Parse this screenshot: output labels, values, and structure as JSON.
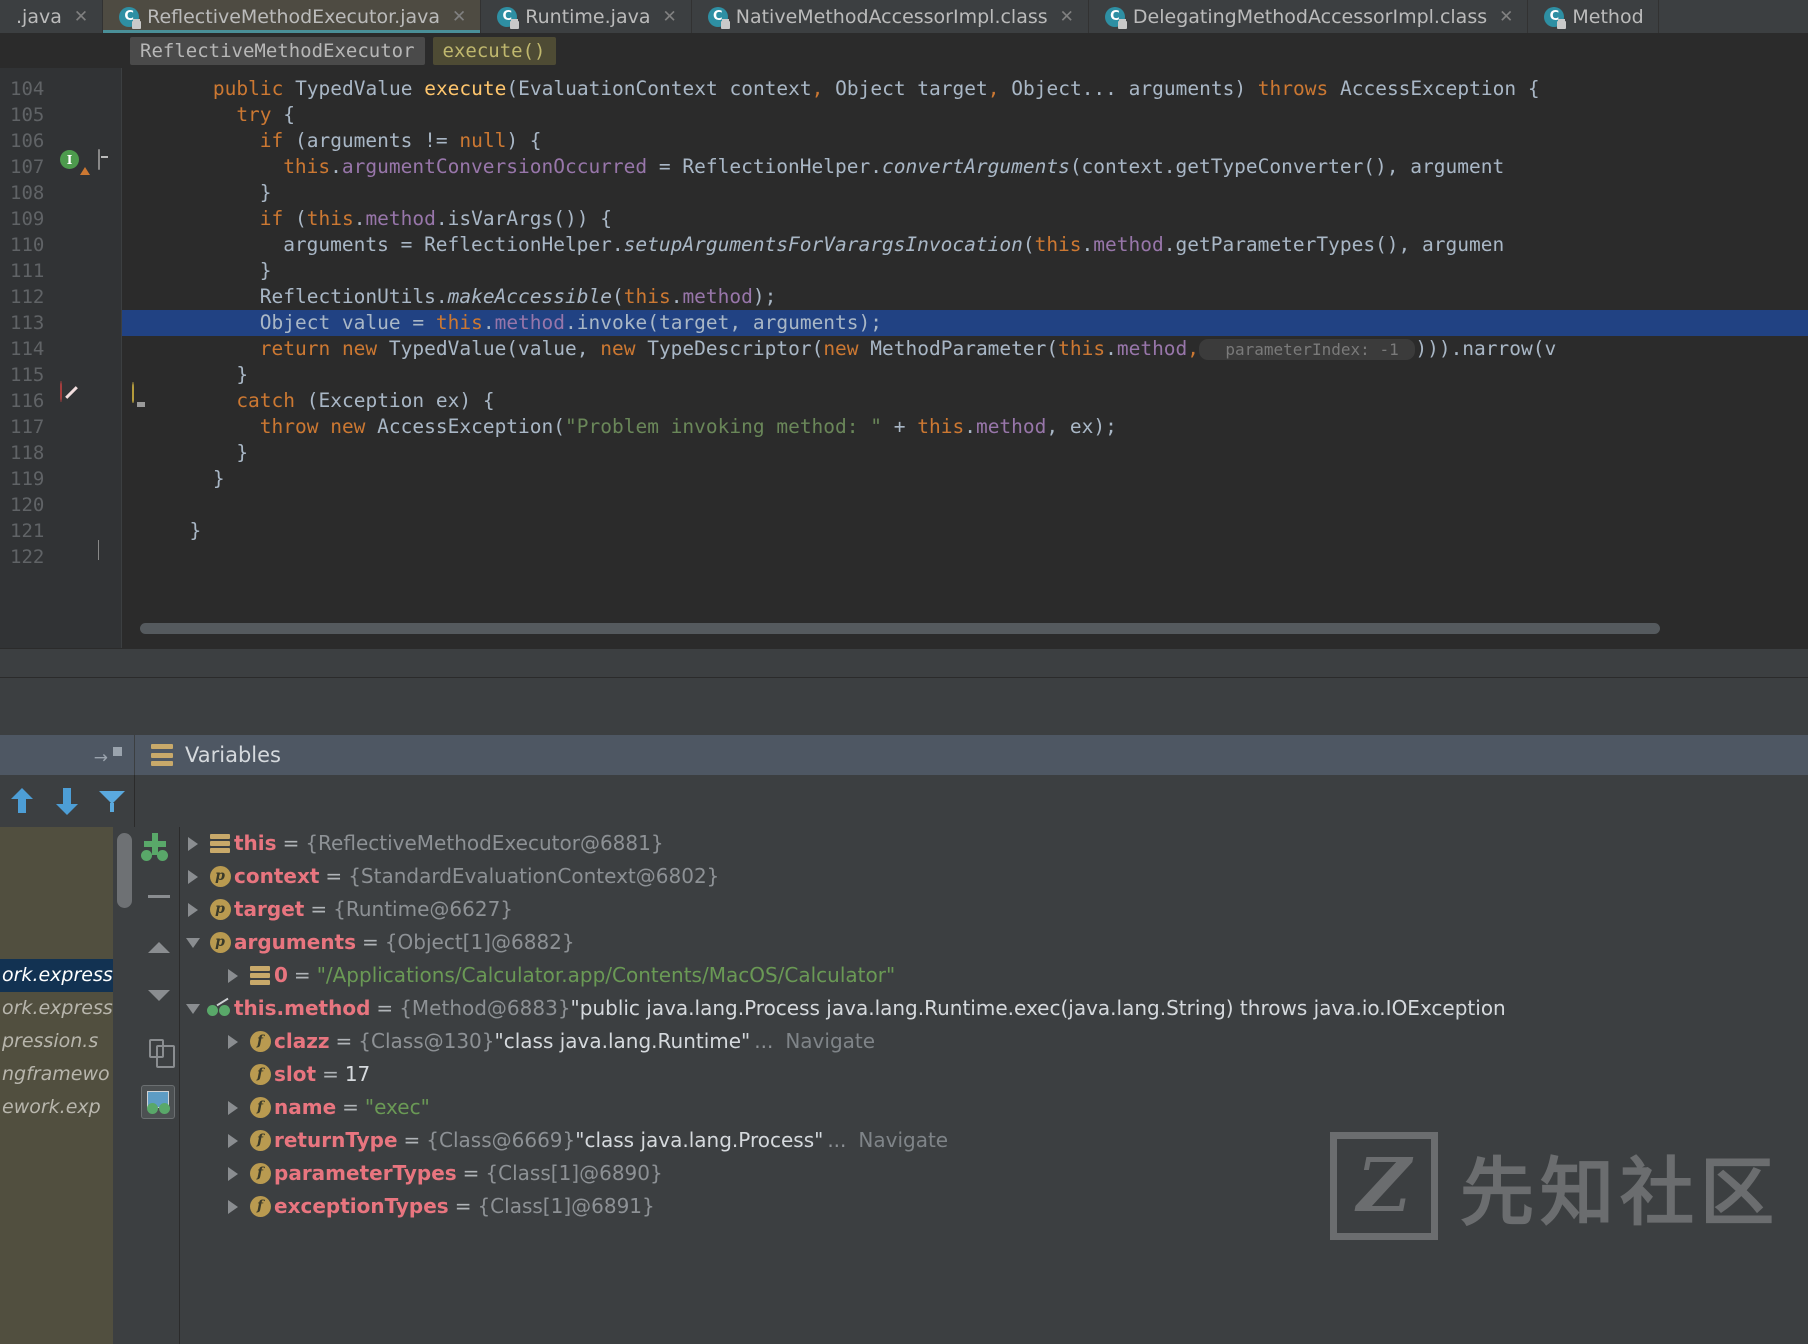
{
  "tabs": [
    {
      "label": ".java",
      "icon": "java-class-icon",
      "active": false,
      "truncated_left": true
    },
    {
      "label": "ReflectiveMethodExecutor.java",
      "icon": "java-class-icon",
      "active": true
    },
    {
      "label": "Runtime.java",
      "icon": "java-class-icon",
      "active": false
    },
    {
      "label": "NativeMethodAccessorImpl.class",
      "icon": "java-class-icon",
      "active": false
    },
    {
      "label": "DelegatingMethodAccessorImpl.class",
      "icon": "java-class-icon",
      "active": false
    },
    {
      "label": "Method",
      "icon": "java-class-icon",
      "active": false,
      "truncated_right": true
    }
  ],
  "tab_close_glyph": "✕",
  "class_icon_letter": "C",
  "breadcrumb": {
    "class": "ReflectiveMethodExecutor",
    "method": "execute()"
  },
  "editor": {
    "first_line": 104,
    "highlighted_line": 113,
    "breakpoint_line": 113,
    "lines": [
      {
        "n": 104,
        "indent": 2,
        "tokens": [
          {
            "t": "public ",
            "c": "kw"
          },
          {
            "t": "TypedValue ",
            "c": "cls"
          },
          {
            "t": "execute",
            "c": "mth"
          },
          {
            "t": "(",
            "c": "cls"
          },
          {
            "t": "EvaluationContext context",
            "c": "cls"
          },
          {
            "t": ",",
            "c": "kw"
          },
          {
            "t": " Object target",
            "c": "cls"
          },
          {
            "t": ",",
            "c": "kw"
          },
          {
            "t": " Object... arguments) ",
            "c": "cls"
          },
          {
            "t": "throws ",
            "c": "kw"
          },
          {
            "t": "AccessException {",
            "c": "cls"
          }
        ]
      },
      {
        "n": 105,
        "indent": 3,
        "tokens": [
          {
            "t": "try",
            "c": "kw"
          },
          {
            "t": " {",
            "c": "cls"
          }
        ]
      },
      {
        "n": 106,
        "indent": 4,
        "tokens": [
          {
            "t": "if",
            "c": "kw"
          },
          {
            "t": " (arguments != ",
            "c": "cls"
          },
          {
            "t": "null",
            "c": "kw"
          },
          {
            "t": ") {",
            "c": "cls"
          }
        ]
      },
      {
        "n": 107,
        "indent": 5,
        "tokens": [
          {
            "t": "this",
            "c": "kw"
          },
          {
            "t": ".",
            "c": "cls"
          },
          {
            "t": "argumentConversionOccurred",
            "c": "fld"
          },
          {
            "t": " = ReflectionHelper.",
            "c": "cls"
          },
          {
            "t": "convertArguments",
            "c": "sta"
          },
          {
            "t": "(context.getTypeConverter(), argument",
            "c": "cls"
          }
        ]
      },
      {
        "n": 108,
        "indent": 4,
        "tokens": [
          {
            "t": "}",
            "c": "cls"
          }
        ]
      },
      {
        "n": 109,
        "indent": 4,
        "tokens": [
          {
            "t": "if",
            "c": "kw"
          },
          {
            "t": " (",
            "c": "cls"
          },
          {
            "t": "this",
            "c": "kw"
          },
          {
            "t": ".",
            "c": "cls"
          },
          {
            "t": "method",
            "c": "fld"
          },
          {
            "t": ".isVarArgs()) {",
            "c": "cls"
          }
        ]
      },
      {
        "n": 110,
        "indent": 5,
        "tokens": [
          {
            "t": "arguments = ReflectionHelper.",
            "c": "cls"
          },
          {
            "t": "setupArgumentsForVarargsInvocation",
            "c": "sta"
          },
          {
            "t": "(",
            "c": "cls"
          },
          {
            "t": "this",
            "c": "kw"
          },
          {
            "t": ".",
            "c": "cls"
          },
          {
            "t": "method",
            "c": "fld"
          },
          {
            "t": ".getParameterTypes(), argumen",
            "c": "cls"
          }
        ]
      },
      {
        "n": 111,
        "indent": 4,
        "tokens": [
          {
            "t": "}",
            "c": "cls"
          }
        ]
      },
      {
        "n": 112,
        "indent": 4,
        "tokens": [
          {
            "t": "ReflectionUtils.",
            "c": "cls"
          },
          {
            "t": "makeAccessible",
            "c": "sta"
          },
          {
            "t": "(",
            "c": "cls"
          },
          {
            "t": "this",
            "c": "kw"
          },
          {
            "t": ".",
            "c": "cls"
          },
          {
            "t": "method",
            "c": "fld"
          },
          {
            "t": ");",
            "c": "cls"
          }
        ]
      },
      {
        "n": 113,
        "indent": 4,
        "highlight": true,
        "tokens": [
          {
            "t": "Object value = ",
            "c": "cls"
          },
          {
            "t": "this",
            "c": "kw"
          },
          {
            "t": ".",
            "c": "cls"
          },
          {
            "t": "method",
            "c": "fld"
          },
          {
            "t": ".invoke(target, arguments);",
            "c": "cls"
          }
        ]
      },
      {
        "n": 114,
        "indent": 4,
        "tokens": [
          {
            "t": "return ",
            "c": "kw"
          },
          {
            "t": "new ",
            "c": "kw"
          },
          {
            "t": "TypedValue(value, ",
            "c": "cls"
          },
          {
            "t": "new ",
            "c": "kw"
          },
          {
            "t": "TypeDescriptor(",
            "c": "cls"
          },
          {
            "t": "new ",
            "c": "kw"
          },
          {
            "t": "MethodParameter(",
            "c": "cls"
          },
          {
            "t": "this",
            "c": "kw"
          },
          {
            "t": ".",
            "c": "cls"
          },
          {
            "t": "method",
            "c": "fld"
          },
          {
            "t": ",",
            "c": "kw"
          }
        ],
        "inlay": "parameterIndex:",
        "inlay_value": "-1",
        "tail": "))).narrow(v"
      },
      {
        "n": 115,
        "indent": 3,
        "tokens": [
          {
            "t": "}",
            "c": "cls"
          }
        ]
      },
      {
        "n": 116,
        "indent": 3,
        "tokens": [
          {
            "t": "catch",
            "c": "kw"
          },
          {
            "t": " (Exception ex) {",
            "c": "cls"
          }
        ]
      },
      {
        "n": 117,
        "indent": 4,
        "tokens": [
          {
            "t": "throw ",
            "c": "kw"
          },
          {
            "t": "new ",
            "c": "kw"
          },
          {
            "t": "AccessException(",
            "c": "cls"
          },
          {
            "t": "\"Problem invoking method: \"",
            "c": "str"
          },
          {
            "t": " + ",
            "c": "cls"
          },
          {
            "t": "this",
            "c": "kw"
          },
          {
            "t": ".",
            "c": "cls"
          },
          {
            "t": "method",
            "c": "fld"
          },
          {
            "t": ", ex);",
            "c": "cls"
          }
        ]
      },
      {
        "n": 118,
        "indent": 3,
        "tokens": [
          {
            "t": "}",
            "c": "cls"
          }
        ]
      },
      {
        "n": 119,
        "indent": 2,
        "tokens": [
          {
            "t": "}",
            "c": "cls"
          }
        ]
      },
      {
        "n": 120,
        "indent": 0,
        "tokens": []
      },
      {
        "n": 121,
        "indent": 1,
        "tokens": [
          {
            "t": "}",
            "c": "cls"
          }
        ]
      },
      {
        "n": 122,
        "indent": 0,
        "tokens": []
      }
    ]
  },
  "debugger": {
    "panel_title": "Variables",
    "panel_icon": "variables-stack-icon",
    "toolbar": [
      {
        "name": "move-up-button",
        "icon": "arrow-up-icon"
      },
      {
        "name": "move-down-button",
        "icon": "arrow-down-icon"
      },
      {
        "name": "filter-button",
        "icon": "funnel-icon"
      }
    ],
    "side_tools": [
      {
        "name": "add-watch-button",
        "icon": "watch-plus-icon"
      },
      {
        "name": "remove-watch-button",
        "icon": "minus-icon"
      },
      {
        "name": "scroll-up-button",
        "icon": "triangle-up-icon"
      },
      {
        "name": "scroll-down-button",
        "icon": "triangle-down-icon"
      },
      {
        "name": "copy-value-button",
        "icon": "copy-icon"
      },
      {
        "name": "show-watches-button",
        "icon": "watches-window-icon"
      }
    ],
    "frames": [
      {
        "text": "",
        "selected": false
      },
      {
        "text": "",
        "selected": false
      },
      {
        "text": "",
        "selected": false
      },
      {
        "text": "",
        "selected": false
      },
      {
        "text": "ork.express",
        "selected": true
      },
      {
        "text": "ork.express",
        "selected": false
      },
      {
        "text": "pression.s",
        "selected": false
      },
      {
        "text": "ngframewo",
        "selected": false
      },
      {
        "text": "ework.exp",
        "selected": false
      }
    ],
    "variables": [
      {
        "depth": 0,
        "toggle": "collapsed",
        "icon": "stack-frame-icon",
        "name": "this",
        "ref": "{ReflectiveMethodExecutor@6881}",
        "value": "",
        "value_kind": "ref"
      },
      {
        "depth": 0,
        "toggle": "collapsed",
        "icon": "parameter-icon",
        "name": "context",
        "ref": "{StandardEvaluationContext@6802}",
        "value": "",
        "value_kind": "ref"
      },
      {
        "depth": 0,
        "toggle": "collapsed",
        "icon": "parameter-icon",
        "name": "target",
        "ref": "{Runtime@6627}",
        "value": "",
        "value_kind": "ref"
      },
      {
        "depth": 0,
        "toggle": "expanded",
        "icon": "parameter-icon",
        "name": "arguments",
        "ref": "{Object[1]@6882}",
        "value": "",
        "value_kind": "ref"
      },
      {
        "depth": 1,
        "toggle": "collapsed",
        "icon": "stack-frame-icon",
        "name": "0",
        "ref": "",
        "value": "\"/Applications/Calculator.app/Contents/MacOS/Calculator\"",
        "value_kind": "string"
      },
      {
        "depth": 0,
        "toggle": "expanded",
        "icon": "watch-icon",
        "name": "this.method",
        "ref": "{Method@6883}",
        "value": "\"public java.lang.Process java.lang.Runtime.exec(java.lang.String) throws java.io.IOException",
        "value_kind": "quoted"
      },
      {
        "depth": 1,
        "toggle": "collapsed",
        "icon": "field-icon",
        "name": "clazz",
        "ref": "{Class@130}",
        "value": "\"class java.lang.Runtime\"",
        "value_kind": "quoted",
        "dots": "...",
        "nav": "Navigate"
      },
      {
        "depth": 1,
        "toggle": "none",
        "icon": "field-icon",
        "name": "slot",
        "ref": "",
        "value": "17",
        "value_kind": "number"
      },
      {
        "depth": 1,
        "toggle": "collapsed",
        "icon": "field-icon",
        "name": "name",
        "ref": "",
        "value": "\"exec\"",
        "value_kind": "string"
      },
      {
        "depth": 1,
        "toggle": "collapsed",
        "icon": "field-icon",
        "name": "returnType",
        "ref": "{Class@6669}",
        "value": "\"class java.lang.Process\"",
        "value_kind": "quoted",
        "dots": "...",
        "nav": "Navigate"
      },
      {
        "depth": 1,
        "toggle": "collapsed",
        "icon": "field-icon",
        "name": "parameterTypes",
        "ref": "{Class[1]@6890}",
        "value": "",
        "value_kind": "ref"
      },
      {
        "depth": 1,
        "toggle": "collapsed",
        "icon": "field-icon",
        "name": "exceptionTypes",
        "ref": "{Class[1]@6891}",
        "value": "",
        "value_kind": "ref"
      }
    ]
  },
  "watermark": {
    "mark": "Z",
    "text": "先知社区"
  },
  "colors": {
    "editor_bg": "#2b2b2b",
    "panel_bg": "#3c3f41",
    "selection": "#214283",
    "accent_tab": "#4a8f98",
    "var_name": "#e8757f",
    "string_value": "#6a9955",
    "keyword": "#cc7832",
    "field": "#9876aa",
    "method": "#ffc66d"
  }
}
